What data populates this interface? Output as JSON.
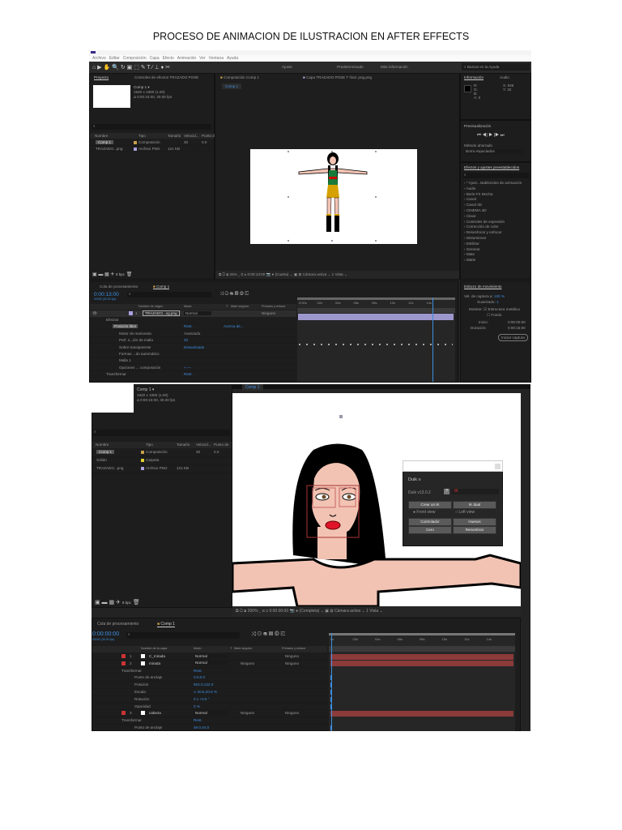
{
  "document_title": "PROCESO DE ANIMACION DE ILUSTRACION EN AFTER EFFECTS",
  "shot1": {
    "menu": [
      "Archivo",
      "Editar",
      "Composición",
      "Capa",
      "Efecto",
      "Animación",
      "Ver",
      "Ventana",
      "Ayuda"
    ],
    "toolbar": {
      "ajuste": "Ajuste",
      "workspace": "Predeterminado",
      "more": "Más información",
      "search": "Buscar en la Ayuda"
    },
    "project": {
      "tab": "Proyecto",
      "effects_tab": "Controles de efectos TRAZADO POSE",
      "comp_name": "Comp 1 ▾",
      "comp_size": "1920 x 1080 (1.00)",
      "comp_duration": "Δ 0:00:15:00, 30.00 fps",
      "columns": [
        "Nombre",
        "Tipo",
        "Tamaño",
        "Velocid...",
        "Punto de"
      ],
      "items": [
        {
          "name": "Comp 1",
          "type": "Composición",
          "size": "",
          "speed": "30",
          "extra": "0.0"
        },
        {
          "name": "TRAZADO...png",
          "type": "Archivo PNG",
          "size": "121 KB",
          "speed": "",
          "extra": ""
        }
      ],
      "bpc": "8 bpc"
    },
    "viewer": {
      "tab": "Composición Comp 1",
      "layer_tab": "Capa TRAZADO POSE T final .png.png",
      "comp_label": "Comp 1",
      "zoom": "25%",
      "time": "0:00:13:00",
      "quality": "(Cuarta)",
      "camera": "Cámara activa",
      "views": "1 Vista"
    },
    "info": {
      "tab": "Información",
      "audio_tab": "Audio",
      "r": "R:",
      "g": "G:",
      "b": "B:",
      "a": "A: 0",
      "x": "X: 936",
      "y": "Y: 32"
    },
    "preview": {
      "title": "Previsualización",
      "method_label": "Método ahorrado",
      "method": "Borra espaciados"
    },
    "effects": {
      "title": "Efectos y ajustes preestablecidos",
      "items": [
        "* Ajust...stablecidos de animación",
        "Audio",
        "Boris FX Mocha",
        "Canal",
        "Canal 3D",
        "CINEMA 4D",
        "Clave",
        "Controles de expresión",
        "Corrección de color",
        "Desenfocar y enfocar",
        "Distorsionar",
        "Estilizar",
        "Generar",
        "Mate",
        "Matte"
      ]
    },
    "timeline": {
      "queue_tab": "Cola de procesamiento",
      "comp_tab": "Comp 1",
      "timecode": "0:00:13:00",
      "frames": "00390 (30.00 fps)",
      "columns": [
        "Nombre de origen",
        "Modo",
        "T",
        "Mate seguim.",
        "Primario y enlace"
      ],
      "ruler": [
        "0:00s",
        "02s",
        "04s",
        "06s",
        "08s",
        "10s",
        "12s",
        "14s"
      ],
      "layer": {
        "num": "1",
        "name": "TRAZADO...xg.png",
        "mode": "Normal",
        "parent": "Ninguno"
      },
      "props": [
        {
          "name": "Efectos",
          "value": ""
        },
        {
          "name": "Posición libre",
          "value": "Rest.",
          "extra": "Acerca de..."
        },
        {
          "name": "Motor de marioneta",
          "value": "Avanzado"
        },
        {
          "name": "Perf. s...ión de malla",
          "value": "20"
        },
        {
          "name": "Sobre transparente",
          "value": "Desactivado"
        },
        {
          "name": "Formas ...do automático",
          "value": ""
        },
        {
          "name": "Malla 1",
          "value": ""
        },
        {
          "name": "Opciones ... composición",
          "value": "+ —"
        },
        {
          "name": "Transformar",
          "value": "Rest."
        }
      ]
    },
    "motion": {
      "title": "Esbozo de movimiento",
      "speed_label": "Vel. de captura a:",
      "speed": "100 %",
      "smooth_label": "Suavizado:",
      "smooth": "1",
      "show_label": "Mostrar:",
      "wire": "Estructura metálica",
      "bg": "Fondo",
      "start_label": "Inicio:",
      "start": "0:00:00:00",
      "dur_label": "Duración:",
      "dur": "0:00:15:00",
      "button": "Iniciar captura"
    }
  },
  "shot2": {
    "project": {
      "comp_name": "Comp 1 ▾",
      "comp_size": "1920 x 1080 (1.00)",
      "comp_duration": "Δ 0:00:15:00, 30.00 fps",
      "columns": [
        "Nombre",
        "Tipo",
        "Tamaño",
        "Velocid...",
        "Punto de"
      ],
      "items": [
        {
          "name": "Comp 1",
          "type": "Composición",
          "size": "",
          "speed": "30",
          "extra": "0.0"
        },
        {
          "name": "Sólido",
          "type": "Carpeta",
          "size": "",
          "speed": "",
          "extra": ""
        },
        {
          "name": "TRAZADO...png",
          "type": "Archivo PNG",
          "size": "121 KB",
          "speed": "",
          "extra": ""
        }
      ],
      "bpc": "8 bpc"
    },
    "viewer": {
      "comp_label": "Comp 1",
      "zoom": "200%",
      "time": "0:00:00:00",
      "quality": "(Completa)",
      "camera": "Cámara activa",
      "views": "1 Vista"
    },
    "duik": {
      "title": "Duik",
      "version": "Duik v13.0.2",
      "help": "?",
      "mode": "IK",
      "create_ik": "Crear un IK",
      "ik_dual": "IK dual",
      "front": "Front view",
      "left": "Left view",
      "controller": "Controlador",
      "bones": "Huesos",
      "zero": "Cero",
      "rename": "Renombrar"
    },
    "timeline": {
      "queue_tab": "Cola de procesamiento",
      "comp_tab": "Comp 1",
      "timecode": "0:00:00:00",
      "frames": "00000 (30.00 fps)",
      "columns": [
        "Nombre de la capa",
        "Modo",
        "T",
        "Mate seguim.",
        "Primario y enlace"
      ],
      "ruler": [
        "0s",
        "02s",
        "04s",
        "06s",
        "08s",
        "10s",
        "12s",
        "14s"
      ],
      "rows": [
        {
          "kind": "layer",
          "num": "1",
          "name": "C_mirada",
          "mode": "Normal",
          "matte": "",
          "parent": "Ninguno"
        },
        {
          "kind": "layer",
          "num": "2",
          "name": "mirada",
          "mode": "Normal",
          "matte": "Ninguno",
          "parent": "Ninguno"
        },
        {
          "kind": "group",
          "name": "Transformar",
          "value": "Rest."
        },
        {
          "kind": "prop",
          "name": "Punto de anclaje",
          "value": "0.0,0.0"
        },
        {
          "kind": "prop",
          "name": "Posición",
          "value": "924.0,122.0"
        },
        {
          "kind": "prop",
          "name": "Escala",
          "value": "∞ 20.5,20.5 %"
        },
        {
          "kind": "prop",
          "name": "Rotación",
          "value": "0 x +0.0 °"
        },
        {
          "kind": "prop",
          "name": "Opacidad",
          "value": "0 %"
        },
        {
          "kind": "layer",
          "num": "3",
          "name": "cabeza",
          "mode": "Normal",
          "matte": "Ninguno",
          "parent": "Ninguno"
        },
        {
          "kind": "group",
          "name": "Transformar",
          "value": "Rest."
        },
        {
          "kind": "prop",
          "name": "Punto de anclaje",
          "value": "49.0,44.0"
        }
      ]
    }
  }
}
